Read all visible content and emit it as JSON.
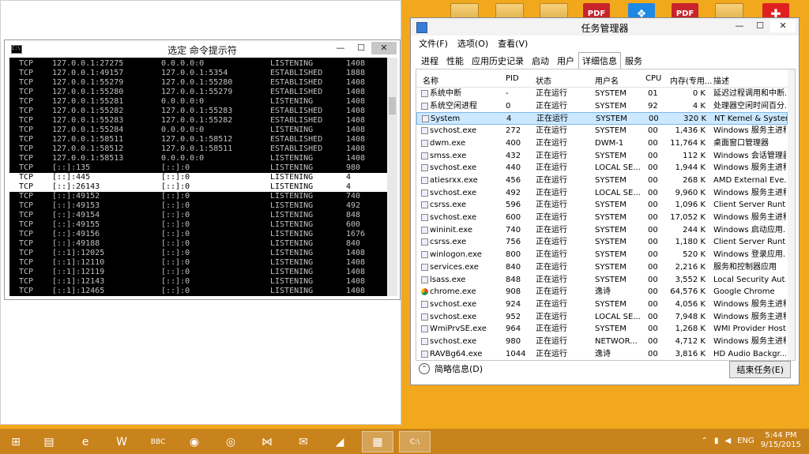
{
  "desktop_icons": [
    {
      "kind": "folder"
    },
    {
      "kind": "folder"
    },
    {
      "kind": "folder"
    },
    {
      "kind": "pdf",
      "label": "PDF"
    },
    {
      "kind": "dropbox",
      "label": "❖"
    },
    {
      "kind": "pdf",
      "label": "PDF"
    },
    {
      "kind": "folder"
    },
    {
      "kind": "red",
      "label": "✚"
    }
  ],
  "cmd": {
    "title": "选定 命令提示符",
    "rows": [
      [
        "TCP",
        "127.0.0.1:27275",
        "0.0.0.0:0",
        "LISTENING",
        "1408"
      ],
      [
        "TCP",
        "127.0.0.1:49157",
        "127.0.0.1:5354",
        "ESTABLISHED",
        "1888"
      ],
      [
        "TCP",
        "127.0.0.1:55279",
        "127.0.0.1:55280",
        "ESTABLISHED",
        "1408"
      ],
      [
        "TCP",
        "127.0.0.1:55280",
        "127.0.0.1:55279",
        "ESTABLISHED",
        "1408"
      ],
      [
        "TCP",
        "127.0.0.1:55281",
        "0.0.0.0:0",
        "LISTENING",
        "1408"
      ],
      [
        "TCP",
        "127.0.0.1:55282",
        "127.0.0.1:55283",
        "ESTABLISHED",
        "1408"
      ],
      [
        "TCP",
        "127.0.0.1:55283",
        "127.0.0.1:55282",
        "ESTABLISHED",
        "1408"
      ],
      [
        "TCP",
        "127.0.0.1:55284",
        "0.0.0.0:0",
        "LISTENING",
        "1408"
      ],
      [
        "TCP",
        "127.0.0.1:58511",
        "127.0.0.1:58512",
        "ESTABLISHED",
        "1408"
      ],
      [
        "TCP",
        "127.0.0.1:58512",
        "127.0.0.1:58511",
        "ESTABLISHED",
        "1408"
      ],
      [
        "TCP",
        "127.0.0.1:58513",
        "0.0.0.0:0",
        "LISTENING",
        "1408"
      ],
      [
        "TCP",
        "[::]:135",
        "[::]:0",
        "LISTENING",
        "980"
      ],
      [
        "TCP",
        "[::]:445",
        "[::]:0",
        "LISTENING",
        "4"
      ],
      [
        "TCP",
        "[::]:26143",
        "[::]:0",
        "LISTENING",
        "4"
      ],
      [
        "TCP",
        "[::]:49152",
        "[::]:0",
        "LISTENING",
        "740"
      ],
      [
        "TCP",
        "[::]:49153",
        "[::]:0",
        "LISTENING",
        "492"
      ],
      [
        "TCP",
        "[::]:49154",
        "[::]:0",
        "LISTENING",
        "848"
      ],
      [
        "TCP",
        "[::]:49155",
        "[::]:0",
        "LISTENING",
        "600"
      ],
      [
        "TCP",
        "[::]:49156",
        "[::]:0",
        "LISTENING",
        "1676"
      ],
      [
        "TCP",
        "[::]:49188",
        "[::]:0",
        "LISTENING",
        "840"
      ],
      [
        "TCP",
        "[::1]:12025",
        "[::]:0",
        "LISTENING",
        "1408"
      ],
      [
        "TCP",
        "[::1]:12110",
        "[::]:0",
        "LISTENING",
        "1408"
      ],
      [
        "TCP",
        "[::1]:12119",
        "[::]:0",
        "LISTENING",
        "1408"
      ],
      [
        "TCP",
        "[::1]:12143",
        "[::]:0",
        "LISTENING",
        "1408"
      ],
      [
        "TCP",
        "[::1]:12465",
        "[::]:0",
        "LISTENING",
        "1408"
      ]
    ],
    "selected_rows": [
      12,
      13
    ]
  },
  "taskmgr": {
    "title": "任务管理器",
    "menu": [
      "文件(F)",
      "选项(O)",
      "查看(V)"
    ],
    "tabs": [
      "进程",
      "性能",
      "应用历史记录",
      "启动",
      "用户",
      "详细信息",
      "服务"
    ],
    "active_tab": 5,
    "columns": {
      "name": "名称",
      "pid": "PID",
      "status": "状态",
      "user": "用户名",
      "cpu": "CPU",
      "mem": "内存(专用...",
      "desc": "描述"
    },
    "rows": [
      {
        "name": "系统中断",
        "pid": "-",
        "status": "正在运行",
        "user": "SYSTEM",
        "cpu": "01",
        "mem": "0 K",
        "desc": "延迟过程调用和中断..."
      },
      {
        "name": "系统空闲进程",
        "pid": "0",
        "status": "正在运行",
        "user": "SYSTEM",
        "cpu": "92",
        "mem": "4 K",
        "desc": "处理器空闲时间百分..."
      },
      {
        "name": "System",
        "pid": "4",
        "status": "正在运行",
        "user": "SYSTEM",
        "cpu": "00",
        "mem": "320 K",
        "desc": "NT Kernel & System"
      },
      {
        "name": "svchost.exe",
        "pid": "272",
        "status": "正在运行",
        "user": "SYSTEM",
        "cpu": "00",
        "mem": "1,436 K",
        "desc": "Windows 服务主进程"
      },
      {
        "name": "dwm.exe",
        "pid": "400",
        "status": "正在运行",
        "user": "DWM-1",
        "cpu": "00",
        "mem": "11,764 K",
        "desc": "桌面窗口管理器"
      },
      {
        "name": "smss.exe",
        "pid": "432",
        "status": "正在运行",
        "user": "SYSTEM",
        "cpu": "00",
        "mem": "112 K",
        "desc": "Windows 会话管理器"
      },
      {
        "name": "svchost.exe",
        "pid": "440",
        "status": "正在运行",
        "user": "LOCAL SE...",
        "cpu": "00",
        "mem": "1,944 K",
        "desc": "Windows 服务主进程"
      },
      {
        "name": "atiesrxx.exe",
        "pid": "456",
        "status": "正在运行",
        "user": "SYSTEM",
        "cpu": "00",
        "mem": "268 K",
        "desc": "AMD External Eve..."
      },
      {
        "name": "svchost.exe",
        "pid": "492",
        "status": "正在运行",
        "user": "LOCAL SE...",
        "cpu": "00",
        "mem": "9,960 K",
        "desc": "Windows 服务主进程"
      },
      {
        "name": "csrss.exe",
        "pid": "596",
        "status": "正在运行",
        "user": "SYSTEM",
        "cpu": "00",
        "mem": "1,096 K",
        "desc": "Client Server Runti..."
      },
      {
        "name": "svchost.exe",
        "pid": "600",
        "status": "正在运行",
        "user": "SYSTEM",
        "cpu": "00",
        "mem": "17,052 K",
        "desc": "Windows 服务主进程"
      },
      {
        "name": "wininit.exe",
        "pid": "740",
        "status": "正在运行",
        "user": "SYSTEM",
        "cpu": "00",
        "mem": "244 K",
        "desc": "Windows 启动应用..."
      },
      {
        "name": "csrss.exe",
        "pid": "756",
        "status": "正在运行",
        "user": "SYSTEM",
        "cpu": "00",
        "mem": "1,180 K",
        "desc": "Client Server Runti..."
      },
      {
        "name": "winlogon.exe",
        "pid": "800",
        "status": "正在运行",
        "user": "SYSTEM",
        "cpu": "00",
        "mem": "520 K",
        "desc": "Windows 登录应用..."
      },
      {
        "name": "services.exe",
        "pid": "840",
        "status": "正在运行",
        "user": "SYSTEM",
        "cpu": "00",
        "mem": "2,216 K",
        "desc": "服务和控制器应用"
      },
      {
        "name": "lsass.exe",
        "pid": "848",
        "status": "正在运行",
        "user": "SYSTEM",
        "cpu": "00",
        "mem": "3,552 K",
        "desc": "Local Security Aut..."
      },
      {
        "name": "chrome.exe",
        "pid": "908",
        "status": "正在运行",
        "user": "逸诗",
        "cpu": "00",
        "mem": "64,576 K",
        "desc": "Google Chrome"
      },
      {
        "name": "svchost.exe",
        "pid": "924",
        "status": "正在运行",
        "user": "SYSTEM",
        "cpu": "00",
        "mem": "4,056 K",
        "desc": "Windows 服务主进程"
      },
      {
        "name": "svchost.exe",
        "pid": "952",
        "status": "正在运行",
        "user": "LOCAL SE...",
        "cpu": "00",
        "mem": "7,948 K",
        "desc": "Windows 服务主进程"
      },
      {
        "name": "WmiPrvSE.exe",
        "pid": "964",
        "status": "正在运行",
        "user": "SYSTEM",
        "cpu": "00",
        "mem": "1,268 K",
        "desc": "WMI Provider Host"
      },
      {
        "name": "svchost.exe",
        "pid": "980",
        "status": "正在运行",
        "user": "NETWOR...",
        "cpu": "00",
        "mem": "4,712 K",
        "desc": "Windows 服务主进程"
      },
      {
        "name": "RAVBg64.exe",
        "pid": "1044",
        "status": "正在运行",
        "user": "逸诗",
        "cpu": "00",
        "mem": "3,816 K",
        "desc": "HD Audio Backgr..."
      }
    ],
    "selected_row": 2,
    "fewer_details": "简略信息(D)",
    "end_task": "结束任务(E)"
  },
  "taskbar": {
    "items": [
      {
        "icon": "start-icon",
        "glyph": "⊞"
      },
      {
        "icon": "file-explorer-icon",
        "glyph": "▤"
      },
      {
        "icon": "ie-icon",
        "glyph": "e"
      },
      {
        "icon": "word-icon",
        "glyph": "W"
      },
      {
        "icon": "bbc-icon",
        "glyph": "BBC"
      },
      {
        "icon": "media-player-icon",
        "glyph": "◉"
      },
      {
        "icon": "chrome-icon",
        "glyph": "◎"
      },
      {
        "icon": "visual-studio-icon",
        "glyph": "⋈"
      },
      {
        "icon": "mail-icon",
        "glyph": "✉"
      },
      {
        "icon": "shark-icon",
        "glyph": "◢"
      },
      {
        "icon": "task-manager-icon",
        "glyph": "▦"
      },
      {
        "icon": "cmd-icon",
        "glyph": "C:\\"
      }
    ],
    "tray_lang": "ENG",
    "time": "5:44 PM",
    "date": "9/15/2015"
  }
}
